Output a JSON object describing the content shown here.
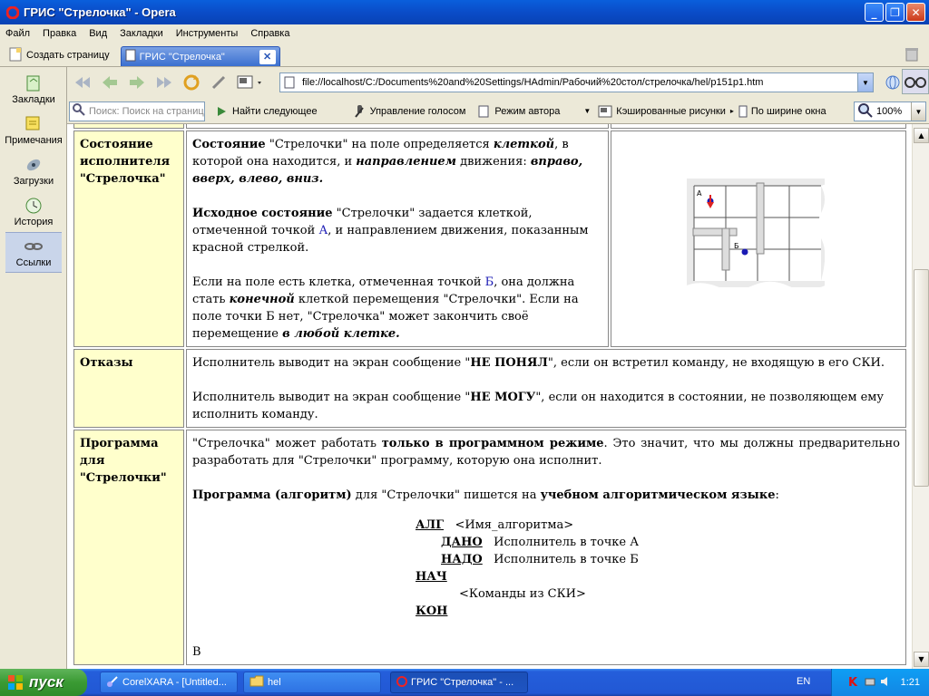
{
  "window": {
    "title": "ГРИС \"Стрелочка\" - Opera"
  },
  "menu": [
    "Файл",
    "Правка",
    "Вид",
    "Закладки",
    "Инструменты",
    "Справка"
  ],
  "tabs": {
    "new_page": "Создать страницу",
    "active": "ГРИС \"Стрелочка\""
  },
  "sidebar": {
    "items": [
      {
        "label": "Закладки",
        "icon": "bookmark-icon"
      },
      {
        "label": "Примечания",
        "icon": "notes-icon"
      },
      {
        "label": "Загрузки",
        "icon": "download-icon"
      },
      {
        "label": "История",
        "icon": "history-icon"
      },
      {
        "label": "Ссылки",
        "icon": "links-icon"
      }
    ]
  },
  "address": {
    "url": "file://localhost/C:/Documents%20and%20Settings/HAdmin/Рабочий%20стол/стрелочка/hel/p151p1.htm"
  },
  "toolbar2": {
    "search_placeholder": "Поиск: Поиск на страниц",
    "find_next": "Найти следующее",
    "voice": "Управление голосом",
    "author_mode": "Режим автора",
    "cached_images": "Кэшированные рисунки",
    "fit_width": "По ширине окна",
    "zoom": "100%"
  },
  "doc": {
    "row1": {
      "label": "Состояние исполнителя \"Стрелочка\"",
      "p1_b1": "Состояние",
      "p1_t1": " \"Стрелочки\" на поле определяется ",
      "p1_bi1": "клеткой",
      "p1_t2": ", в которой она находится, и ",
      "p1_bi2": "направлением",
      "p1_t3": " движения: ",
      "p1_bi3": "вправо, вверх, влево, вниз.",
      "p2_b1": "Исходное состояние",
      "p2_t1": " \"Стрелочки\" задается клеткой, отмеченной точкой ",
      "p2_a": "А",
      "p2_t2": ", и направлением движения, показанным красной стрелкой.",
      "p3_t1": "Если на поле есть клетка, отмеченная точкой ",
      "p3_b": "Б",
      "p3_t2": ", она должна стать ",
      "p3_bi1": "конечной",
      "p3_t3": " клеткой перемещения \"Стрелочки\". Если на поле точки Б нет, \"Стрелочка\" может закончить своё перемещение ",
      "p3_bi2": "в любой клетке.",
      "pic_label_a": "А",
      "pic_label_b": "Б"
    },
    "row2": {
      "label": "Отказы",
      "p1_t1": "Исполнитель выводит на экран сообщение \"",
      "p1_b": "НЕ ПОНЯЛ",
      "p1_t2": "\", если он встретил команду, не входящую в его СКИ.",
      "p2_t1": "Исполнитель выводит на экран сообщение \"",
      "p2_b": "НЕ МОГУ",
      "p2_t2": "\", если он находится в состоянии, не позволяющем ему исполнить команду."
    },
    "row3": {
      "label": "Программа для \"Стрелочки\"",
      "p1_t1": "\"Стрелочка\" может работать ",
      "p1_b": "только в программном режиме",
      "p1_t2": ". Это значит, что мы должны предварительно разработать для \"Стрелочки\" программу, которую она исполнит.",
      "p2_b1": "Программа (алгоритм)",
      "p2_t1": " для \"Стрелочки\" пишется на ",
      "p2_b2": "учебном алгоритмическом языке",
      "p2_t2": ":",
      "alg_kw": "АЛГ",
      "alg_name": "<Имя_алгоритма>",
      "dano_kw": "ДАНО",
      "dano_text": "Исполнитель в точке А",
      "nado_kw": "НАДО",
      "nado_text": "Исполнитель в точке Б",
      "nach_kw": "НАЧ",
      "cmds": "<Команды из СКИ>",
      "kon_kw": "КОН",
      "trailing": "В"
    }
  },
  "taskbar": {
    "start": "пуск",
    "items": [
      {
        "label": "CorelXARA - [Untitled..."
      },
      {
        "label": "hel"
      },
      {
        "label": "ГРИС \"Стрелочка\" - ..."
      }
    ],
    "lang": "EN",
    "clock": "1:21"
  }
}
